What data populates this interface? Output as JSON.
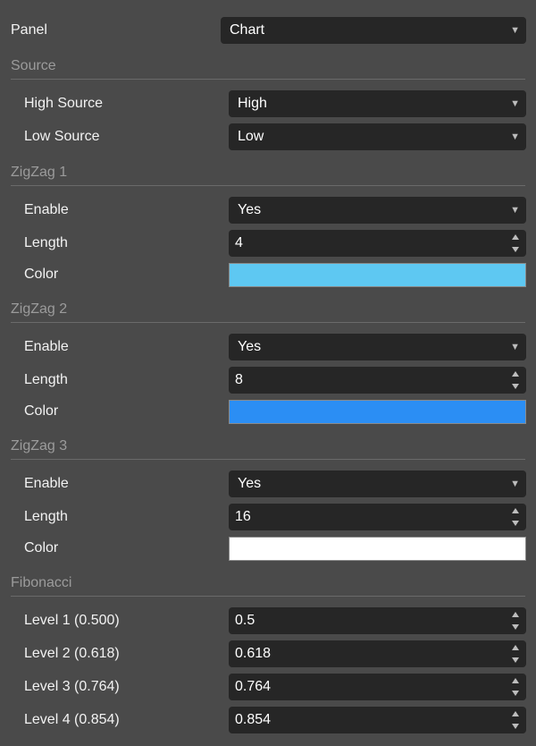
{
  "panel": {
    "label": "Panel",
    "value": "Chart"
  },
  "source": {
    "title": "Source",
    "high_label": "High Source",
    "high_value": "High",
    "low_label": "Low Source",
    "low_value": "Low"
  },
  "zigzag1": {
    "title": "ZigZag 1",
    "enable_label": "Enable",
    "enable_value": "Yes",
    "length_label": "Length",
    "length_value": "4",
    "color_label": "Color",
    "color": "#5ec8f2"
  },
  "zigzag2": {
    "title": "ZigZag 2",
    "enable_label": "Enable",
    "enable_value": "Yes",
    "length_label": "Length",
    "length_value": "8",
    "color_label": "Color",
    "color": "#2b8ef4"
  },
  "zigzag3": {
    "title": "ZigZag 3",
    "enable_label": "Enable",
    "enable_value": "Yes",
    "length_label": "Length",
    "length_value": "16",
    "color_label": "Color",
    "color": "#ffffff"
  },
  "fibonacci": {
    "title": "Fibonacci",
    "levels": [
      {
        "label": "Level 1 (0.500)",
        "value": "0.5"
      },
      {
        "label": "Level 2 (0.618)",
        "value": "0.618"
      },
      {
        "label": "Level 3 (0.764)",
        "value": "0.764"
      },
      {
        "label": "Level 4 (0.854)",
        "value": "0.854"
      }
    ]
  },
  "icons": {
    "dropdown": "chevron-down-icon",
    "spinner": "spinner-icon"
  }
}
